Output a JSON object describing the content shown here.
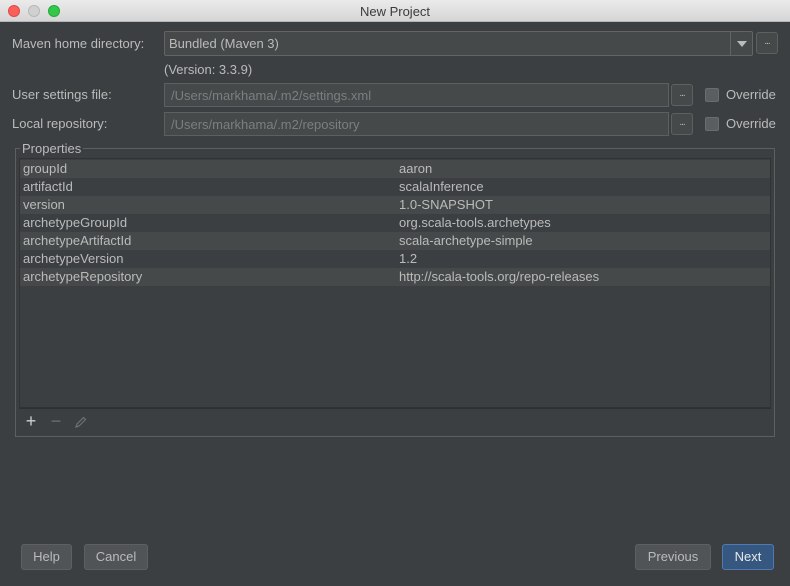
{
  "window": {
    "title": "New Project"
  },
  "maven_home": {
    "label": "Maven home directory:",
    "value": "Bundled (Maven 3)",
    "version": "(Version: 3.3.9)",
    "browse": "..."
  },
  "user_settings": {
    "label": "User settings file:",
    "value": "/Users/markhama/.m2/settings.xml",
    "browse": "...",
    "override_label": "Override",
    "override_checked": false
  },
  "local_repo": {
    "label": "Local repository:",
    "value": "/Users/markhama/.m2/repository",
    "browse": "...",
    "override_label": "Override",
    "override_checked": false
  },
  "properties": {
    "title": "Properties",
    "rows": [
      {
        "key": "groupId",
        "value": "aaron"
      },
      {
        "key": "artifactId",
        "value": "scalaInference"
      },
      {
        "key": "version",
        "value": "1.0-SNAPSHOT"
      },
      {
        "key": "archetypeGroupId",
        "value": "org.scala-tools.archetypes"
      },
      {
        "key": "archetypeArtifactId",
        "value": "scala-archetype-simple"
      },
      {
        "key": "archetypeVersion",
        "value": "1.2"
      },
      {
        "key": "archetypeRepository",
        "value": "http://scala-tools.org/repo-releases"
      }
    ],
    "toolbar": {
      "add_icon": "plus-icon",
      "remove_icon": "minus-icon",
      "edit_icon": "pencil-icon"
    }
  },
  "buttons": {
    "help": "Help",
    "cancel": "Cancel",
    "previous": "Previous",
    "next": "Next"
  },
  "colors": {
    "background": "#3c3f41",
    "primary_button": "#365880",
    "text": "#bbbbbb"
  }
}
